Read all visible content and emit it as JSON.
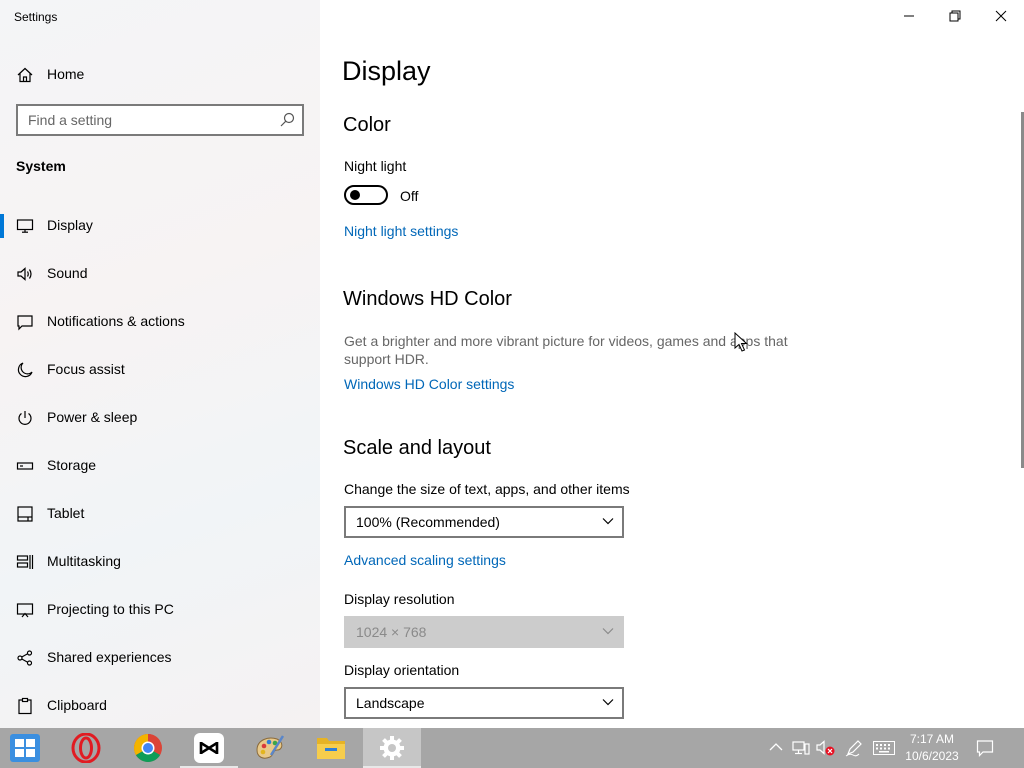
{
  "window": {
    "title": "Settings",
    "controls": {
      "minimize": "minimize-icon",
      "restore": "restore-icon",
      "close": "close-icon"
    }
  },
  "sidebar": {
    "home_label": "Home",
    "search_placeholder": "Find a setting",
    "section_title": "System",
    "items": [
      {
        "label": "Display",
        "icon": "monitor-icon",
        "active": true
      },
      {
        "label": "Sound",
        "icon": "speaker-icon"
      },
      {
        "label": "Notifications & actions",
        "icon": "notification-icon"
      },
      {
        "label": "Focus assist",
        "icon": "moon-icon"
      },
      {
        "label": "Power & sleep",
        "icon": "power-icon"
      },
      {
        "label": "Storage",
        "icon": "storage-icon"
      },
      {
        "label": "Tablet",
        "icon": "tablet-icon"
      },
      {
        "label": "Multitasking",
        "icon": "multitasking-icon"
      },
      {
        "label": "Projecting to this PC",
        "icon": "projecting-icon"
      },
      {
        "label": "Shared experiences",
        "icon": "shared-experiences-icon"
      },
      {
        "label": "Clipboard",
        "icon": "clipboard-icon"
      }
    ]
  },
  "main": {
    "page_title": "Display",
    "color": {
      "heading": "Color",
      "night_light_label": "Night light",
      "night_light_state": "Off",
      "night_light_link": "Night light settings"
    },
    "hd_color": {
      "heading": "Windows HD Color",
      "description": "Get a brighter and more vibrant picture for videos, games and apps that support HDR.",
      "link": "Windows HD Color settings"
    },
    "scale": {
      "heading": "Scale and layout",
      "size_label": "Change the size of text, apps, and other items",
      "size_value": "100% (Recommended)",
      "advanced_link": "Advanced scaling settings",
      "resolution_label": "Display resolution",
      "resolution_value": "1024 × 768",
      "orientation_label": "Display orientation",
      "orientation_value": "Landscape"
    }
  },
  "taskbar": {
    "apps": [
      "start-icon",
      "opera-icon",
      "chrome-icon",
      "capcut-icon",
      "paint-icon",
      "file-explorer-icon",
      "settings-icon"
    ],
    "time": "7:17 AM",
    "date": "10/6/2023"
  },
  "colors": {
    "accent": "#0078d7",
    "link": "#0067b8",
    "taskbar": "#a6a6a6"
  }
}
